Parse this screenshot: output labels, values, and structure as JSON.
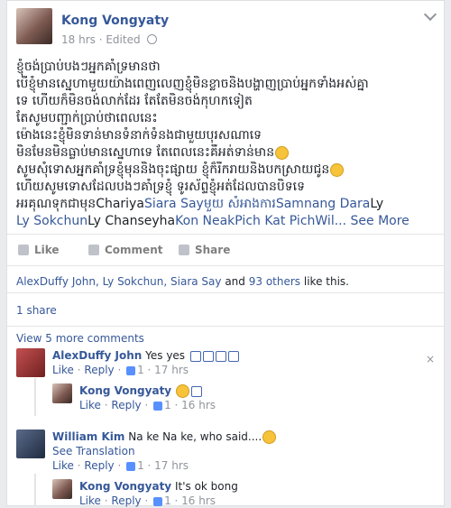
{
  "post": {
    "author": "Kong Vongyaty",
    "time": "18 hrs",
    "edited": "Edited",
    "lines": [
      "ខ្ញុំចង់ប្រាប់បងៗអ្នកគាំទ្រមានថា",
      "បើខ្ញុំមានស្នេហាមួយយ៉ាងពេញលេញខ្ញុំមិនខ្លាចនិងបង្ហាញប្រាប់អ្នកទាំងអស់គ្នា",
      "ទេ ហើយក៏មិនចង់លាក់ដែរ តែតែមិនចង់កុហកទៀត",
      "តែសូមបញ្ជាក់ប្រាប់ថាពេលនេះ",
      "ម៉ោងនេះខ្ញុំមិនទាន់មានទំនាក់ទំនងជាមួយបុរសណាទេ",
      "មិនមែនមិនធ្លាប់មានស្នេហាទេ តែពេលនេះគឺអត់ទាន់មាន",
      "សូមសុំទោសអ្នកគាំទ្រខ្ញុំមុននិងចុះផ្សាយ ខ្ញុំក៏រីករាយនិងបកស្រាយជូន",
      "ហើយសូមទោសដែលបងៗគាំទ្រខ្ញុំ ទូរស័ព្ទខ្ញុំអត់ដែលបានបិទទេ"
    ],
    "last_line_prefix": "អរគុណទុកជាមុន",
    "tags": [
      "Chariya",
      "Siara Say",
      "មួយ",
      " សំអាងការ",
      "Samnang Dara",
      "Ly Sokchun",
      "Ly Chanseyha",
      "Kon Neak",
      "Pich Kat Pich",
      "Wil..."
    ],
    "tag_line1_plain_suffix": "Ly",
    "see_more": "See More"
  },
  "actions": {
    "like": "Like",
    "comment": "Comment",
    "share": "Share"
  },
  "likes_summary": {
    "names": "AlexDuffy John, Ly Sokchun, Siara Say",
    "and": "and",
    "others": "93 others",
    "suffix": "like this."
  },
  "shares": "1 share",
  "view_more": "View 5 more comments",
  "comments": [
    {
      "name": "AlexDuffy John",
      "text": "Yes yes",
      "like": "Like",
      "reply": "Reply",
      "count": "1",
      "time": "17 hrs"
    },
    {
      "name": "Kong Vongyaty",
      "text": "",
      "like": "Like",
      "reply": "Reply",
      "count": "1",
      "time": "16 hrs"
    },
    {
      "name": "William Kim",
      "text": "Na ke Na ke, who said....",
      "see_translation": "See Translation",
      "like": "Like",
      "reply": "Reply",
      "count": "1",
      "time": "17 hrs"
    },
    {
      "name": "Kong Vongyaty",
      "text": "It's ok bong",
      "like": "Like",
      "reply": "Reply",
      "count": "1",
      "time": "16 hrs"
    }
  ],
  "close_icon": "×",
  "colors": {
    "link": "#365899",
    "muted": "#90949c",
    "bg": "#e9ebee"
  }
}
